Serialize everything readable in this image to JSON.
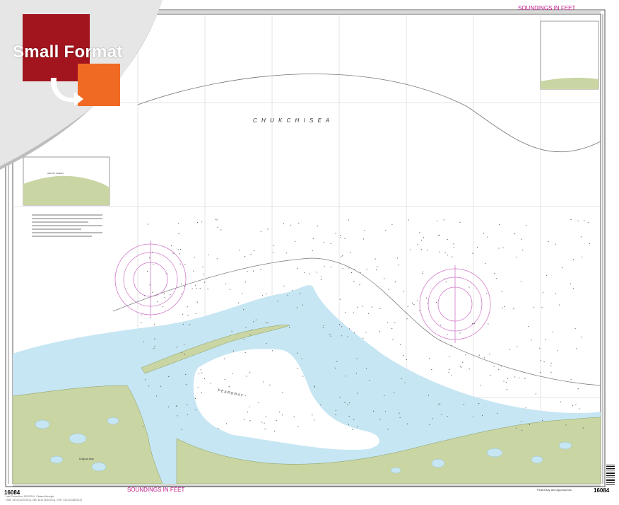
{
  "badge": {
    "text": "Small Format"
  },
  "chart": {
    "number": "16084",
    "units_label": "SOUNDINGS IN FEET",
    "sea_label": "C H U K C H I   S E A",
    "bay_label": "P E A R D   B A Y",
    "place_label": "Kugrua Bay",
    "inset_label": "ARCTIC OCEAN",
    "title_block": "Peard Bay and Approaches",
    "edition_note": "Last Correction: 5/22/2014. Cleared through:",
    "lnm_note": "LNM: 1614 (4/22/2014), NM: 1614 (5/3/2014), CHS: 2314 (2/28/2014)"
  },
  "colors": {
    "land": "#c9d6a4",
    "land_dark": "#a9bd7c",
    "shallow_water": "#c7e6f3",
    "deep_water": "#ffffff",
    "compass": "#d178c8",
    "grid": "#bfbfbf",
    "badge_red": "#a3151e",
    "badge_orange": "#f06a23"
  }
}
